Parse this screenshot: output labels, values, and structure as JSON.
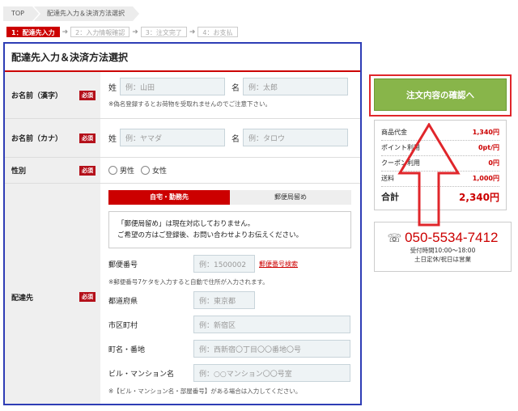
{
  "breadcrumb": [
    "TOP",
    "配達先入力＆決済方法選択"
  ],
  "steps": [
    "1：配達先入力",
    "2：入力情報確認",
    "3：注文完了",
    "4：お支払"
  ],
  "form": {
    "title": "配達先入力＆決済方法選択",
    "required": "必須",
    "name_kanji": {
      "label": "お名前（漢字）",
      "last_key": "姓",
      "last_ph": "例：山田",
      "first_key": "名",
      "first_ph": "例：太郎",
      "note": "※偽名登録するとお荷物を受取れませんのでご注意下さい。"
    },
    "name_kana": {
      "label": "お名前（カナ）",
      "last_key": "姓",
      "last_ph": "例：ヤマダ",
      "first_key": "名",
      "first_ph": "例：タロウ"
    },
    "gender": {
      "label": "性別",
      "male": "男性",
      "female": "女性"
    },
    "delivery": {
      "label": "配達先",
      "tab_home": "自宅・勤務先",
      "tab_post": "郵便局留め",
      "notice_1": "「郵便局留め」は現在対応しておりません。",
      "notice_2": "ご希望の方はご登録後、お問い合わせよりお伝えください。",
      "postal_label": "郵便番号",
      "postal_ph": "例：1500002",
      "postal_link": "郵便番号検索",
      "postal_note": "※郵便番号7ケタを入力すると自動で住所が入力されます。",
      "pref_label": "都道府県",
      "pref_ph": "例：東京都",
      "city_label": "市区町村",
      "city_ph": "例：新宿区",
      "town_label": "町名・番地",
      "town_ph": "例：西新宿〇丁目〇〇番地〇号",
      "bldg_label": "ビル・マンション名",
      "bldg_ph": "例：○○マンション〇〇号室",
      "bldg_note": "※【ビル・マンション名・部屋番号】がある場合は入力してください。"
    }
  },
  "sidebar": {
    "confirm_button": "注文内容の確認へ",
    "summary": [
      {
        "label": "商品代金",
        "value": "1,340円"
      },
      {
        "label": "ポイント利用",
        "value": "0pt/円"
      },
      {
        "label": "クーポン利用",
        "value": "0円"
      },
      {
        "label": "送料",
        "value": "1,000円"
      }
    ],
    "total_label": "合計",
    "total_value": "2,340円",
    "phone": "050-5534-7412",
    "hours": "受付時間10:00～18:00",
    "holiday": "土日定休/祝日は営業"
  },
  "colors": {
    "accent": "#cc0000",
    "confirm": "#88b54a",
    "frame_blue": "#2e3db5",
    "frame_red": "#e0262b"
  }
}
